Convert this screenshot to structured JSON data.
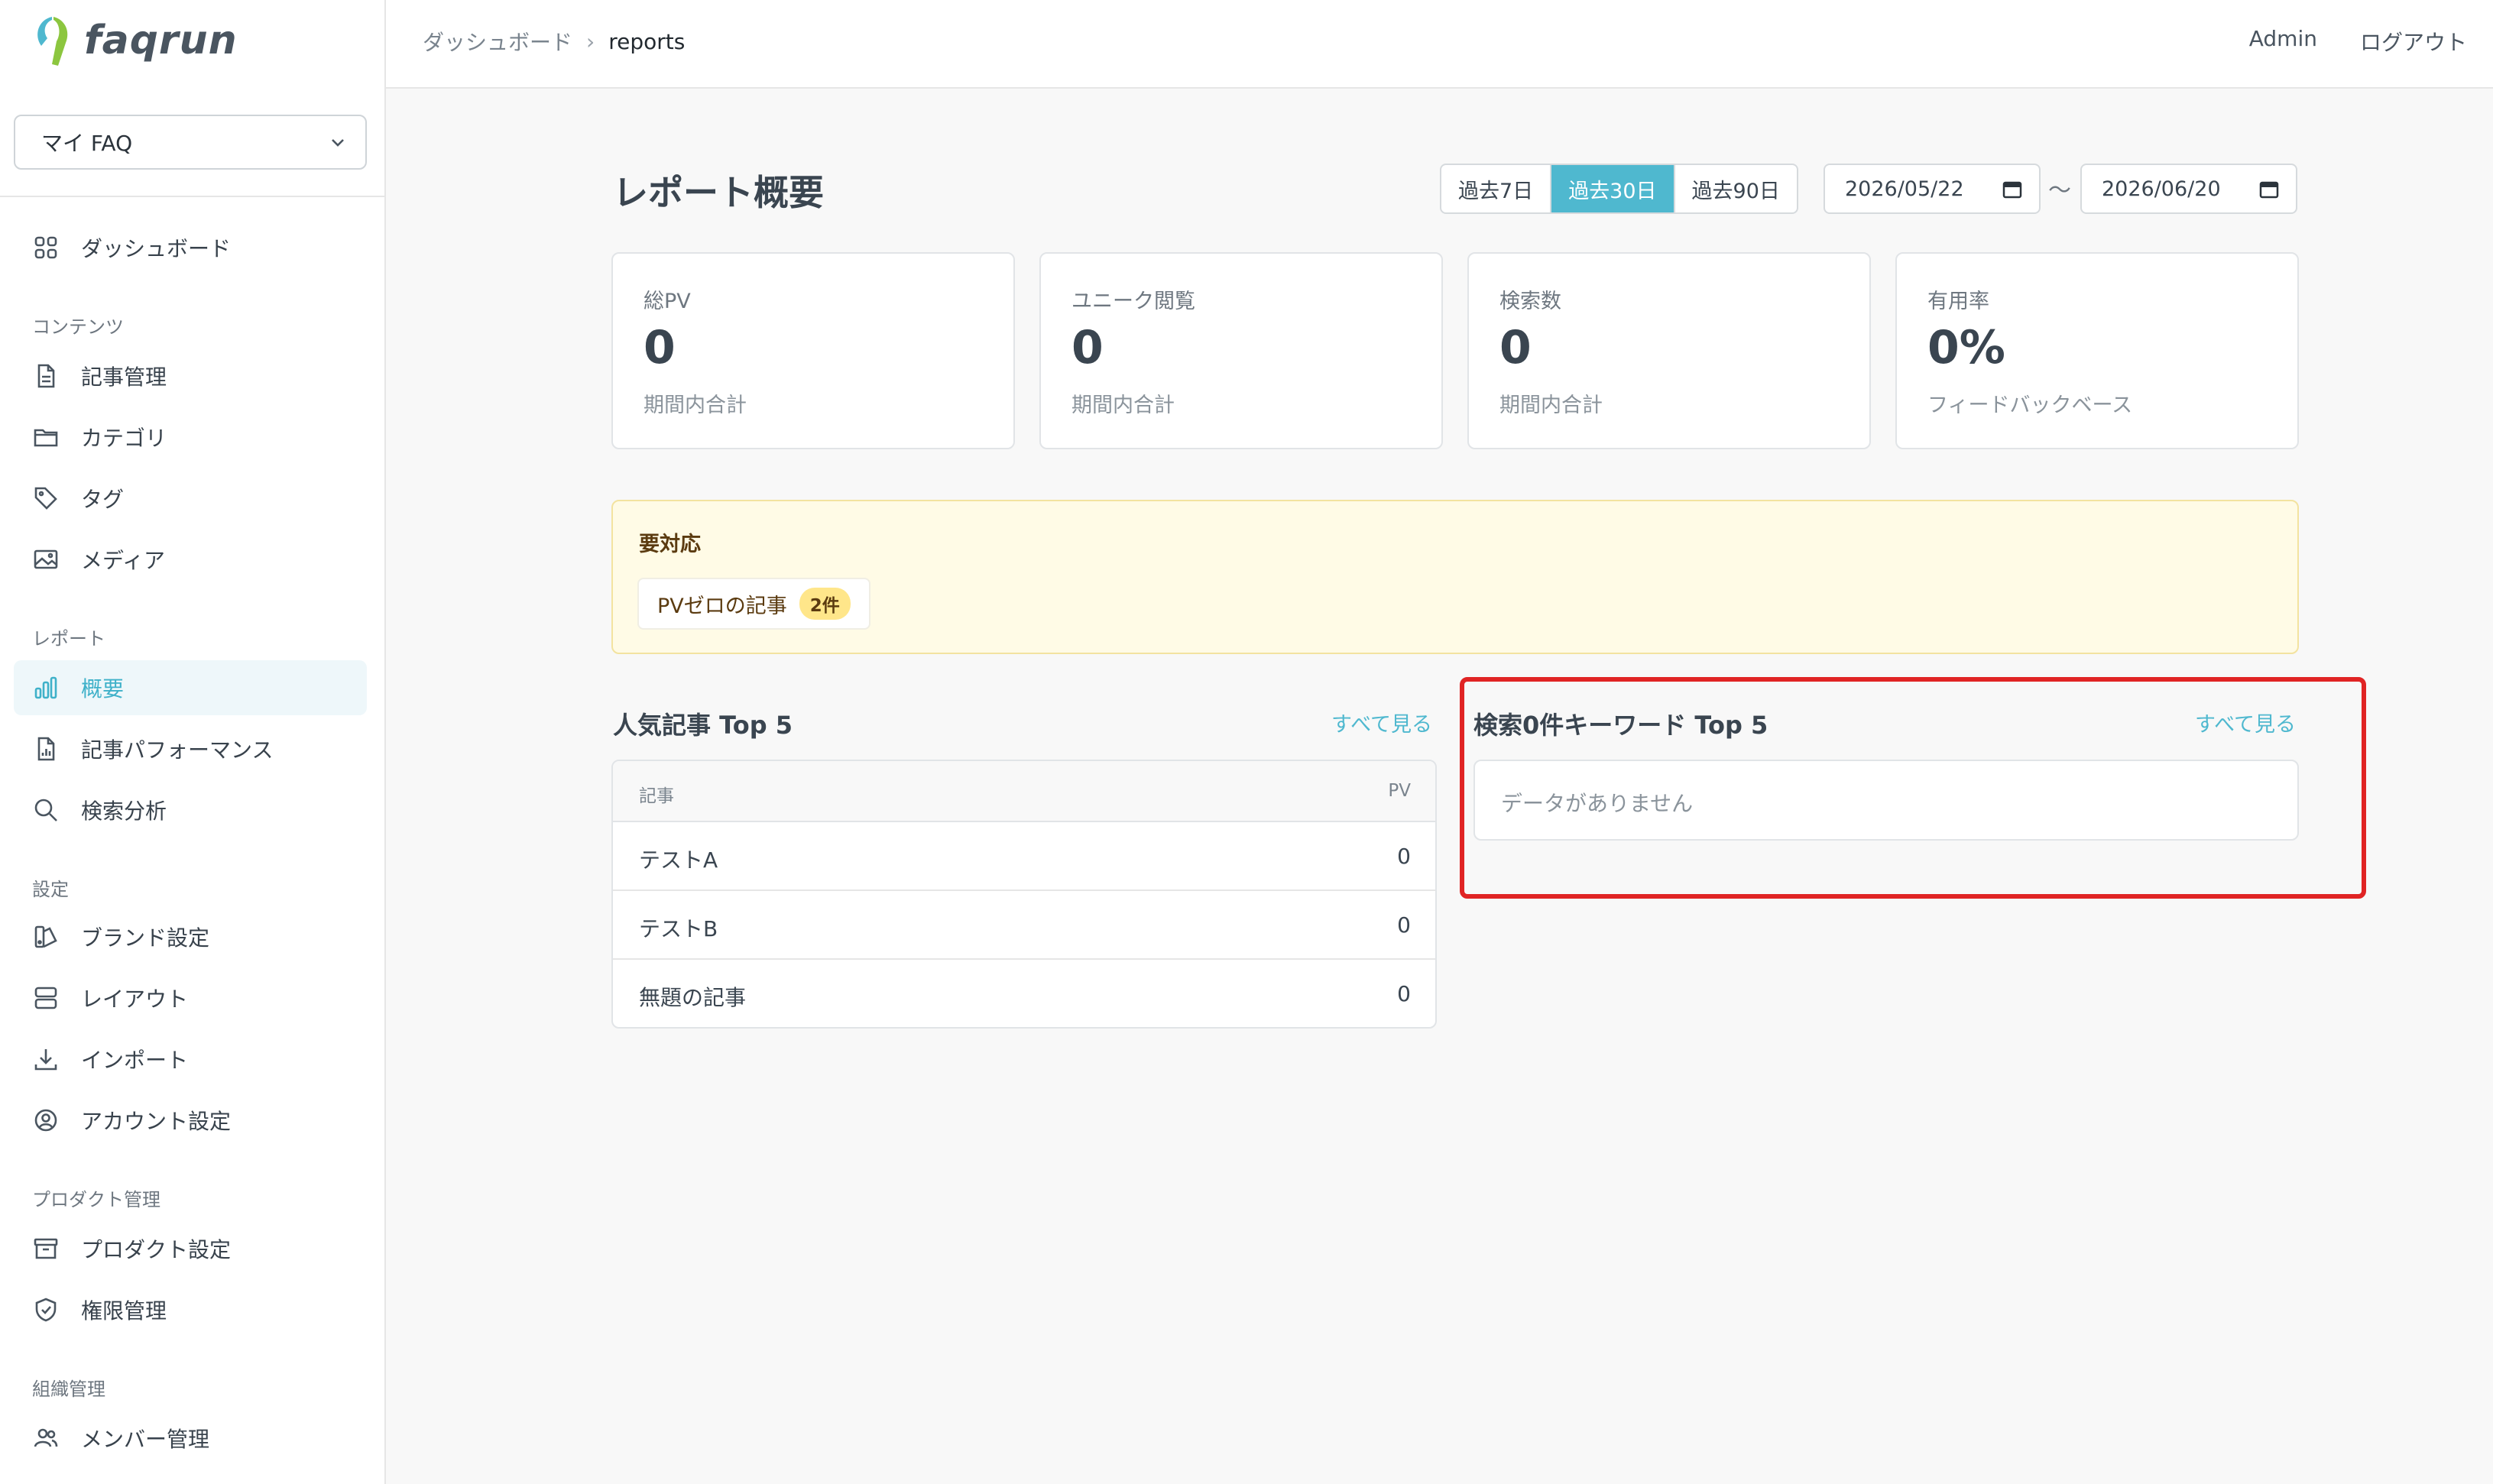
{
  "app": {
    "logo_text": "faqrun"
  },
  "faq_select": {
    "value": "マイ FAQ"
  },
  "sidebar": {
    "top": {
      "label": "ダッシュボード",
      "icon": "grid-icon"
    },
    "sections": {
      "content": "コンテンツ",
      "reports": "レポート",
      "settings": "設定",
      "product": "プロダクト管理",
      "org": "組織管理"
    },
    "content_items": [
      {
        "label": "記事管理",
        "icon": "document-icon"
      },
      {
        "label": "カテゴリ",
        "icon": "folder-icon"
      },
      {
        "label": "タグ",
        "icon": "tag-icon"
      },
      {
        "label": "メディア",
        "icon": "image-icon"
      }
    ],
    "report_items": [
      {
        "label": "概要",
        "icon": "bar-chart-icon",
        "active": true
      },
      {
        "label": "記事パフォーマンス",
        "icon": "file-chart-icon"
      },
      {
        "label": "検索分析",
        "icon": "search-icon"
      }
    ],
    "settings_items": [
      {
        "label": "ブランド設定",
        "icon": "palette-icon"
      },
      {
        "label": "レイアウト",
        "icon": "layout-icon"
      },
      {
        "label": "インポート",
        "icon": "download-icon"
      },
      {
        "label": "アカウント設定",
        "icon": "user-circle-icon"
      }
    ],
    "product_items": [
      {
        "label": "プロダクト設定",
        "icon": "archive-icon"
      },
      {
        "label": "権限管理",
        "icon": "shield-icon"
      }
    ],
    "org_items": [
      {
        "label": "メンバー管理",
        "icon": "users-icon"
      }
    ]
  },
  "breadcrumb": {
    "parent": "ダッシュボード",
    "current": "reports"
  },
  "header": {
    "user": "Admin",
    "logout": "ログアウト"
  },
  "page": {
    "title": "レポート概要"
  },
  "range": {
    "options": [
      "過去7日",
      "過去30日",
      "過去90日"
    ],
    "selected": "過去30日",
    "from": "2026/05/22",
    "to": "2026/06/20",
    "separator": "〜"
  },
  "stats": [
    {
      "label": "総PV",
      "value": "0",
      "sub": "期間内合計"
    },
    {
      "label": "ユニーク閲覧",
      "value": "0",
      "sub": "期間内合計"
    },
    {
      "label": "検索数",
      "value": "0",
      "sub": "期間内合計"
    },
    {
      "label": "有用率",
      "value": "0%",
      "sub": "フィードバックベース"
    }
  ],
  "alert": {
    "title": "要対応",
    "chip_label": "PVゼロの記事",
    "chip_badge": "2件"
  },
  "popular": {
    "title": "人気記事 Top 5",
    "see_all": "すべて見る",
    "headers": {
      "article": "記事",
      "pv": "PV"
    },
    "rows": [
      {
        "name": "テストA",
        "pv": "0"
      },
      {
        "name": "テストB",
        "pv": "0"
      },
      {
        "name": "無題の記事",
        "pv": "0"
      }
    ]
  },
  "zero_search": {
    "title": "検索0件キーワード Top 5",
    "see_all": "すべて見る",
    "empty": "データがありません"
  },
  "colors": {
    "accent": "#4fb8cf",
    "highlight": "#e02424",
    "alert_bg": "#fffbe6"
  }
}
